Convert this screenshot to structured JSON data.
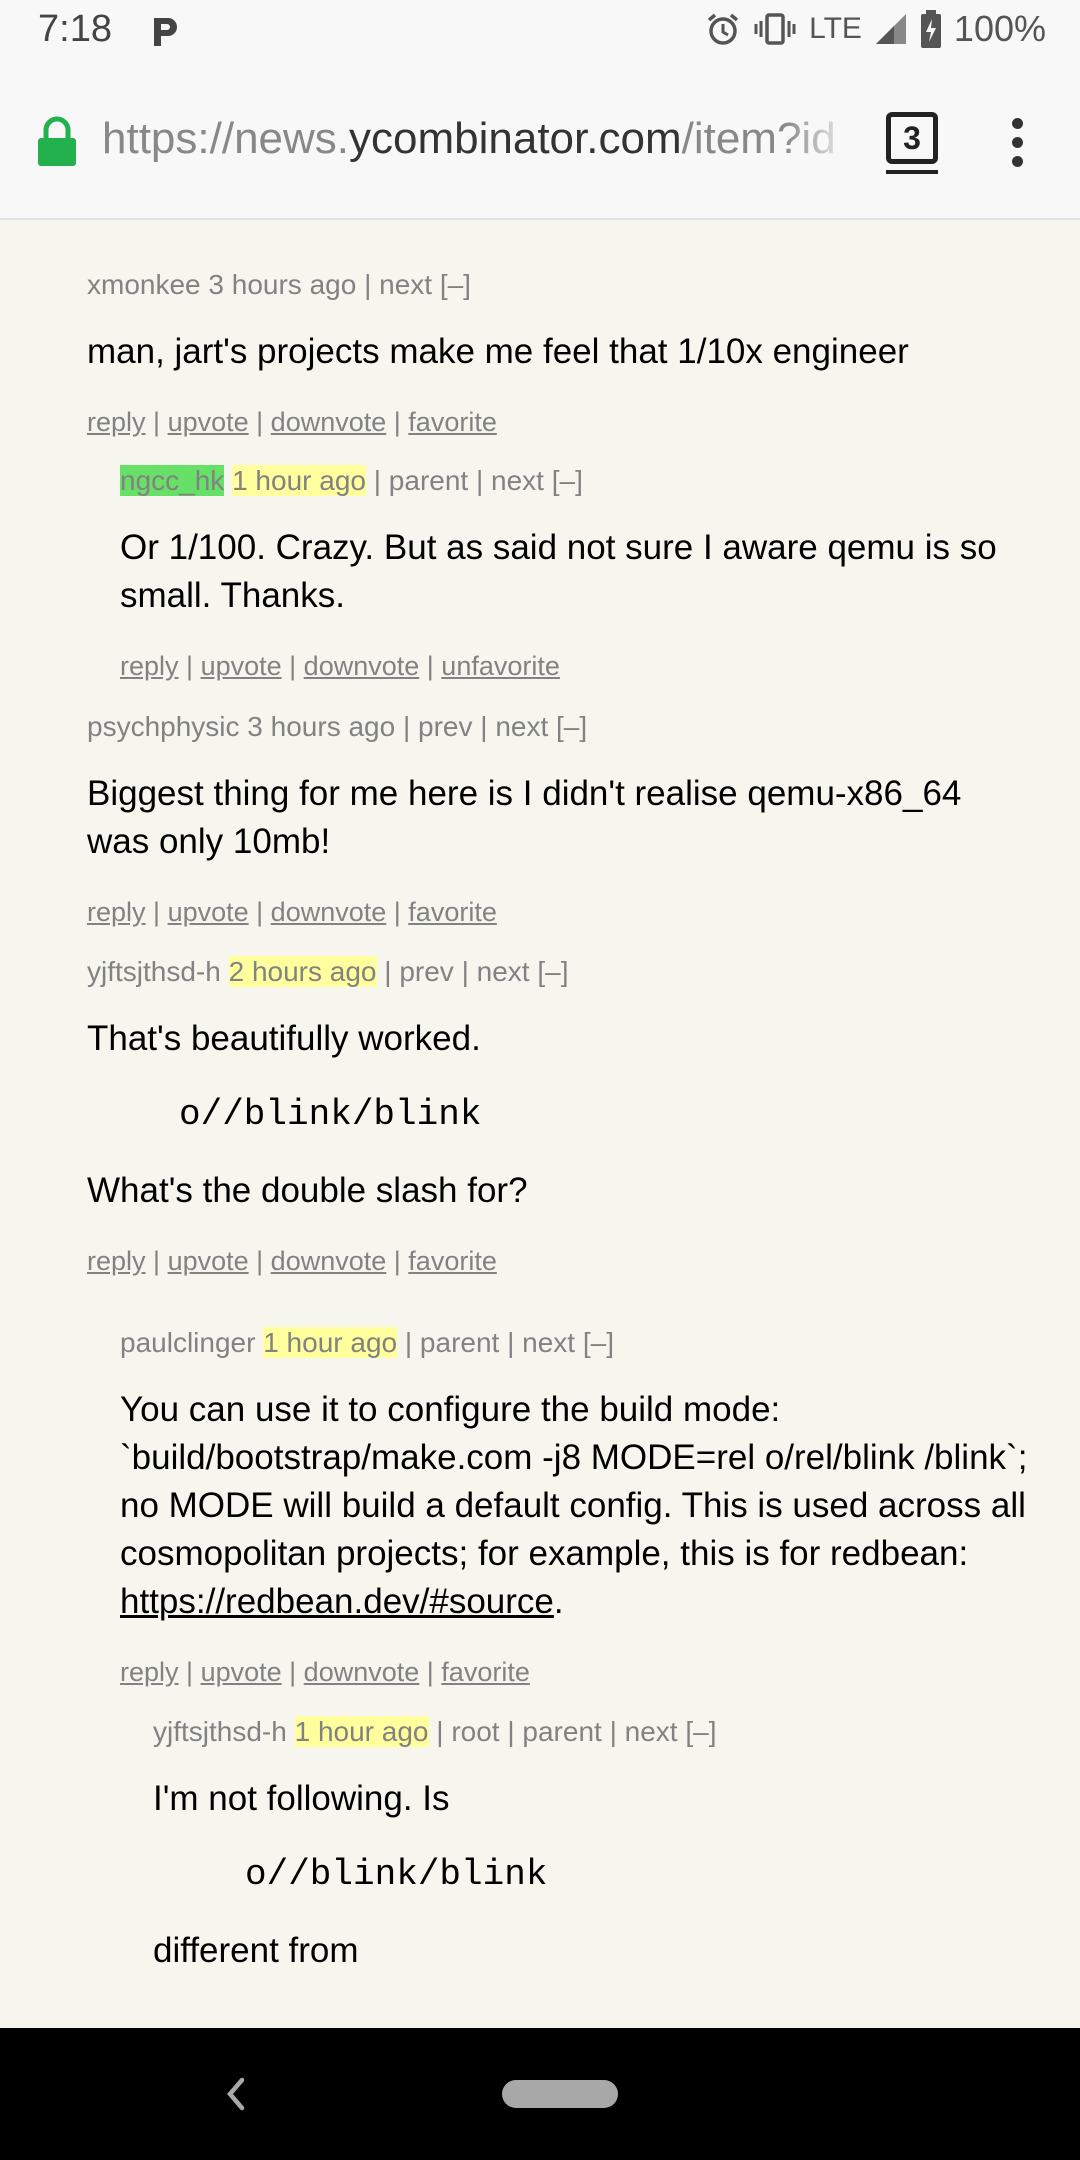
{
  "status_bar": {
    "time": "7:18",
    "network": "LTE",
    "battery": "100%"
  },
  "address_bar": {
    "url_scheme": "https://news.",
    "url_host": "ycombinator.com",
    "url_path": "/item?id",
    "tab_count": "3"
  },
  "comments": [
    {
      "user": "xmonkee",
      "age": "3 hours ago",
      "nav": " | next [–]",
      "paragraphs": [
        "man, jart's projects make me feel that 1/10x engineer"
      ],
      "actions": [
        "reply",
        "upvote",
        "downvote",
        "favorite"
      ]
    },
    {
      "user": "ngcc_hk",
      "age": "1 hour ago",
      "nav": " | parent | next [–]",
      "paragraphs": [
        "Or 1/100. Crazy. But as said not sure I aware qemu is so small. Thanks."
      ],
      "actions": [
        "reply",
        "upvote",
        "downvote",
        "unfavorite"
      ]
    },
    {
      "user": "psychphysic",
      "age": "3 hours ago",
      "nav": " | prev | next [–]",
      "paragraphs": [
        "Biggest thing for me here is I didn't realise qemu-x86_64 was only 10mb!"
      ],
      "actions": [
        "reply",
        "upvote",
        "downvote",
        "favorite"
      ]
    },
    {
      "user": "yjftsjthsd-h",
      "age": "2 hours ago",
      "nav": " | prev | next [–]",
      "paragraphs": [
        "That's beautifully worked.",
        "What's the double slash for?"
      ],
      "code": "o//blink/blink",
      "actions": [
        "reply",
        "upvote",
        "downvote",
        "favorite"
      ]
    },
    {
      "user": "paulclinger",
      "age": "1 hour ago",
      "nav": " | parent | next [–]",
      "paragraphs": [
        "You can use it to configure the build mode: `build/bootstrap/make.com -j8 MODE=rel o/rel/blink /blink`; no MODE will build a default config. This is used across all cosmopolitan projects; for example, this is for redbean: "
      ],
      "link": "https://redbean.dev/#source",
      "actions": [
        "reply",
        "upvote",
        "downvote",
        "favorite"
      ]
    },
    {
      "user": "yjftsjthsd-h",
      "age": "1 hour ago",
      "nav": " | root | parent | next [–]",
      "paragraphs": [
        "I'm not following. Is",
        "different from"
      ],
      "code": "o//blink/blink"
    }
  ],
  "colors": {
    "page_bg": "#f6f6ef",
    "meta_gray": "#828282",
    "new_user_green": "#66e066",
    "recent_yellow": "#ffff9e",
    "lock_green": "#22b14c"
  },
  "icons": [
    "p-notification-icon",
    "alarm-icon",
    "vibrate-icon",
    "signal-icon",
    "battery-icon",
    "lock-icon",
    "menu-icon",
    "back-icon",
    "home-pill-icon"
  ]
}
